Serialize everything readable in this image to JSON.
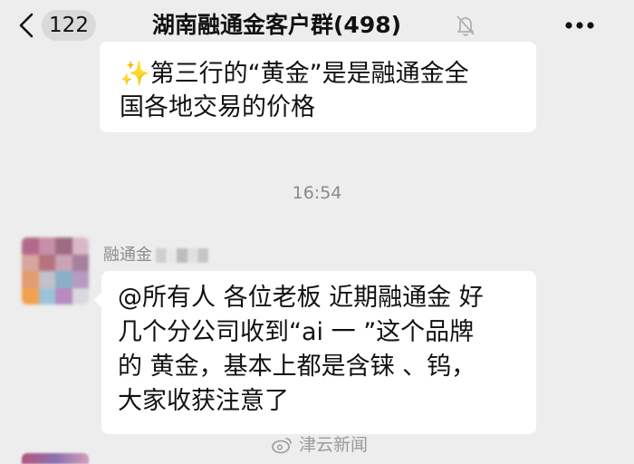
{
  "header": {
    "unread_count": "122",
    "title": "湖南融通金客户群(498)",
    "icons": [
      "chevron-left-icon",
      "mute-bell-icon",
      "more-icon"
    ]
  },
  "messages": [
    {
      "lines": [
        "✨第三行的“黄金”是是融通金全",
        "国各地交易的价格"
      ]
    }
  ],
  "timestamp": "16:54",
  "message2": {
    "sender": "融通金",
    "lines": [
      "@所有人  各位老板 近期融通金 好",
      "几个分公司收到“ai 一 ”这个品牌",
      "的 黄金，基本上都是含铼  、钨，",
      "大家收获注意了"
    ]
  },
  "watermark": {
    "text": "津云新闻"
  },
  "colors": {
    "background": "#ededed",
    "bubble": "#ffffff",
    "muted_text": "#8a8a8a"
  }
}
